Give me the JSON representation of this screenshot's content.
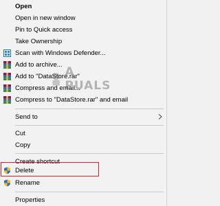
{
  "menu": {
    "items": [
      {
        "key": "open",
        "label": "Open",
        "bold": true,
        "icon": ""
      },
      {
        "key": "open_new_window",
        "label": "Open in new window",
        "icon": ""
      },
      {
        "key": "pin_quick_access",
        "label": "Pin to Quick access",
        "icon": ""
      },
      {
        "key": "take_ownership",
        "label": "Take Ownership",
        "icon": ""
      },
      {
        "key": "scan_defender",
        "label": "Scan with Windows Defender...",
        "icon": "windows-defender-icon"
      },
      {
        "key": "add_archive",
        "label": "Add to archive...",
        "icon": "winrar-icon"
      },
      {
        "key": "add_datastore_rar",
        "label": "Add to \"DataStore.rar\"",
        "icon": "winrar-icon"
      },
      {
        "key": "compress_email",
        "label": "Compress and email...",
        "icon": "winrar-icon"
      },
      {
        "key": "compress_datastore_email",
        "label": "Compress to \"DataStore.rar\" and email",
        "icon": "winrar-icon"
      },
      {
        "key": "send_to",
        "label": "Send to",
        "icon": "",
        "submenu": true
      },
      {
        "key": "cut",
        "label": "Cut",
        "icon": ""
      },
      {
        "key": "copy",
        "label": "Copy",
        "icon": ""
      },
      {
        "key": "create_shortcut",
        "label": "Create shortcut",
        "icon": ""
      },
      {
        "key": "delete",
        "label": "Delete",
        "icon": "uac-shield-icon",
        "highlighted": true
      },
      {
        "key": "rename",
        "label": "Rename",
        "icon": "uac-shield-icon"
      },
      {
        "key": "properties",
        "label": "Properties",
        "icon": ""
      }
    ]
  },
  "colors": {
    "menu_bg": "#f2f2f2",
    "highlight_border": "#d9202c",
    "separator": "#c8c8c8"
  },
  "watermark": {
    "text": "A PUALS"
  }
}
